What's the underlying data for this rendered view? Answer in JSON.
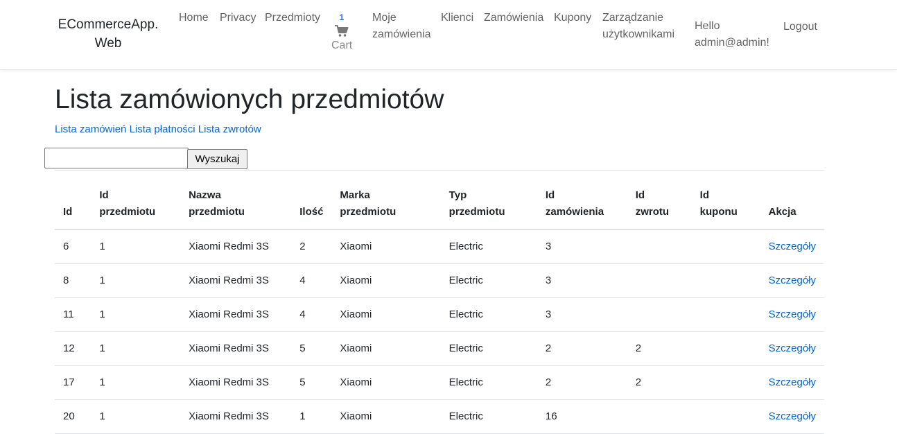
{
  "navbar": {
    "brand_line1": "ECommerceApp.",
    "brand_line2": "Web",
    "home": "Home",
    "privacy": "Privacy",
    "items": "Przedmioty",
    "cart_count": "1",
    "cart_label": "Cart",
    "my_orders_line1": "Moje",
    "my_orders_line2": "zamówienia",
    "customers": "Klienci",
    "orders": "Zamówienia",
    "coupons": "Kupony",
    "user_mgmt_line1": "Zarządzanie",
    "user_mgmt_line2": "użytkownikami",
    "hello_line1": "Hello",
    "hello_line2": "admin@admin!",
    "logout": "Logout",
    "cart_icon": "shopping-cart-icon"
  },
  "page": {
    "title": "Lista zamówionych przedmiotów",
    "links": [
      "Lista zamówień",
      "Lista płatności",
      "Lista zwrotów"
    ]
  },
  "search": {
    "value": "",
    "button": "Wyszukaj"
  },
  "table": {
    "headers": [
      [
        "Id"
      ],
      [
        "Id",
        "przedmiotu"
      ],
      [
        "Nazwa",
        "przedmiotu"
      ],
      [
        "Ilość"
      ],
      [
        "Marka",
        "przedmiotu"
      ],
      [
        "Typ",
        "przedmiotu"
      ],
      [
        "Id",
        "zamówienia"
      ],
      [
        "Id",
        "zwrotu"
      ],
      [
        "Id",
        "kuponu"
      ],
      [
        "Akcja"
      ]
    ],
    "rows": [
      {
        "id": "6",
        "item_id": "1",
        "name": "Xiaomi Redmi 3S",
        "qty": "2",
        "brand": "Xiaomi",
        "type": "Electric",
        "order_id": "3",
        "refund_id": "",
        "coupon_id": "",
        "action": "Szczegóły"
      },
      {
        "id": "8",
        "item_id": "1",
        "name": "Xiaomi Redmi 3S",
        "qty": "4",
        "brand": "Xiaomi",
        "type": "Electric",
        "order_id": "3",
        "refund_id": "",
        "coupon_id": "",
        "action": "Szczegóły"
      },
      {
        "id": "11",
        "item_id": "1",
        "name": "Xiaomi Redmi 3S",
        "qty": "4",
        "brand": "Xiaomi",
        "type": "Electric",
        "order_id": "3",
        "refund_id": "",
        "coupon_id": "",
        "action": "Szczegóły"
      },
      {
        "id": "12",
        "item_id": "1",
        "name": "Xiaomi Redmi 3S",
        "qty": "5",
        "brand": "Xiaomi",
        "type": "Electric",
        "order_id": "2",
        "refund_id": "2",
        "coupon_id": "",
        "action": "Szczegóły"
      },
      {
        "id": "17",
        "item_id": "1",
        "name": "Xiaomi Redmi 3S",
        "qty": "5",
        "brand": "Xiaomi",
        "type": "Electric",
        "order_id": "2",
        "refund_id": "2",
        "coupon_id": "",
        "action": "Szczegóły"
      },
      {
        "id": "20",
        "item_id": "1",
        "name": "Xiaomi Redmi 3S",
        "qty": "1",
        "brand": "Xiaomi",
        "type": "Electric",
        "order_id": "16",
        "refund_id": "",
        "coupon_id": "",
        "action": "Szczegóły"
      }
    ]
  },
  "colors": {
    "link": "#0366d6",
    "badge": "#1a73e8",
    "border": "#dee2e6"
  }
}
